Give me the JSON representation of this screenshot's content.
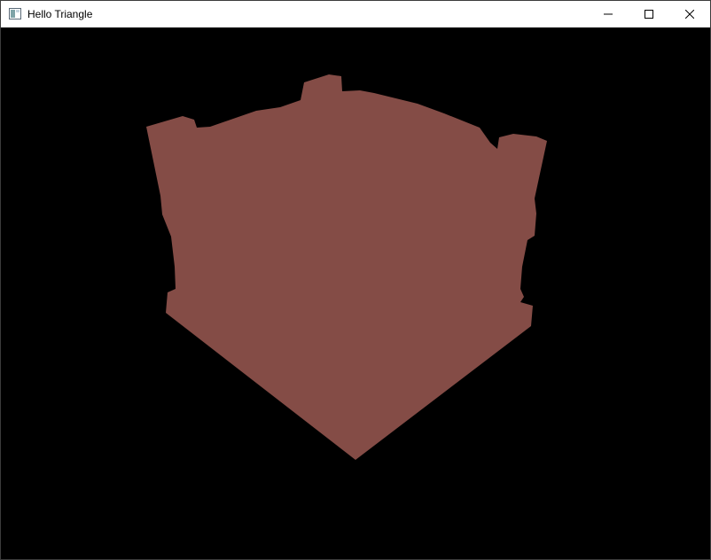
{
  "window": {
    "title": "Hello Triangle",
    "icon": "app-window-icon",
    "controls": {
      "minimize_icon": "minimize-icon",
      "maximize_icon": "maximize-icon",
      "close_icon": "close-icon"
    }
  },
  "viewport": {
    "background_color": "#000000",
    "model_fill_color": "#844c46",
    "model_icon": "rendered-3d-model"
  }
}
